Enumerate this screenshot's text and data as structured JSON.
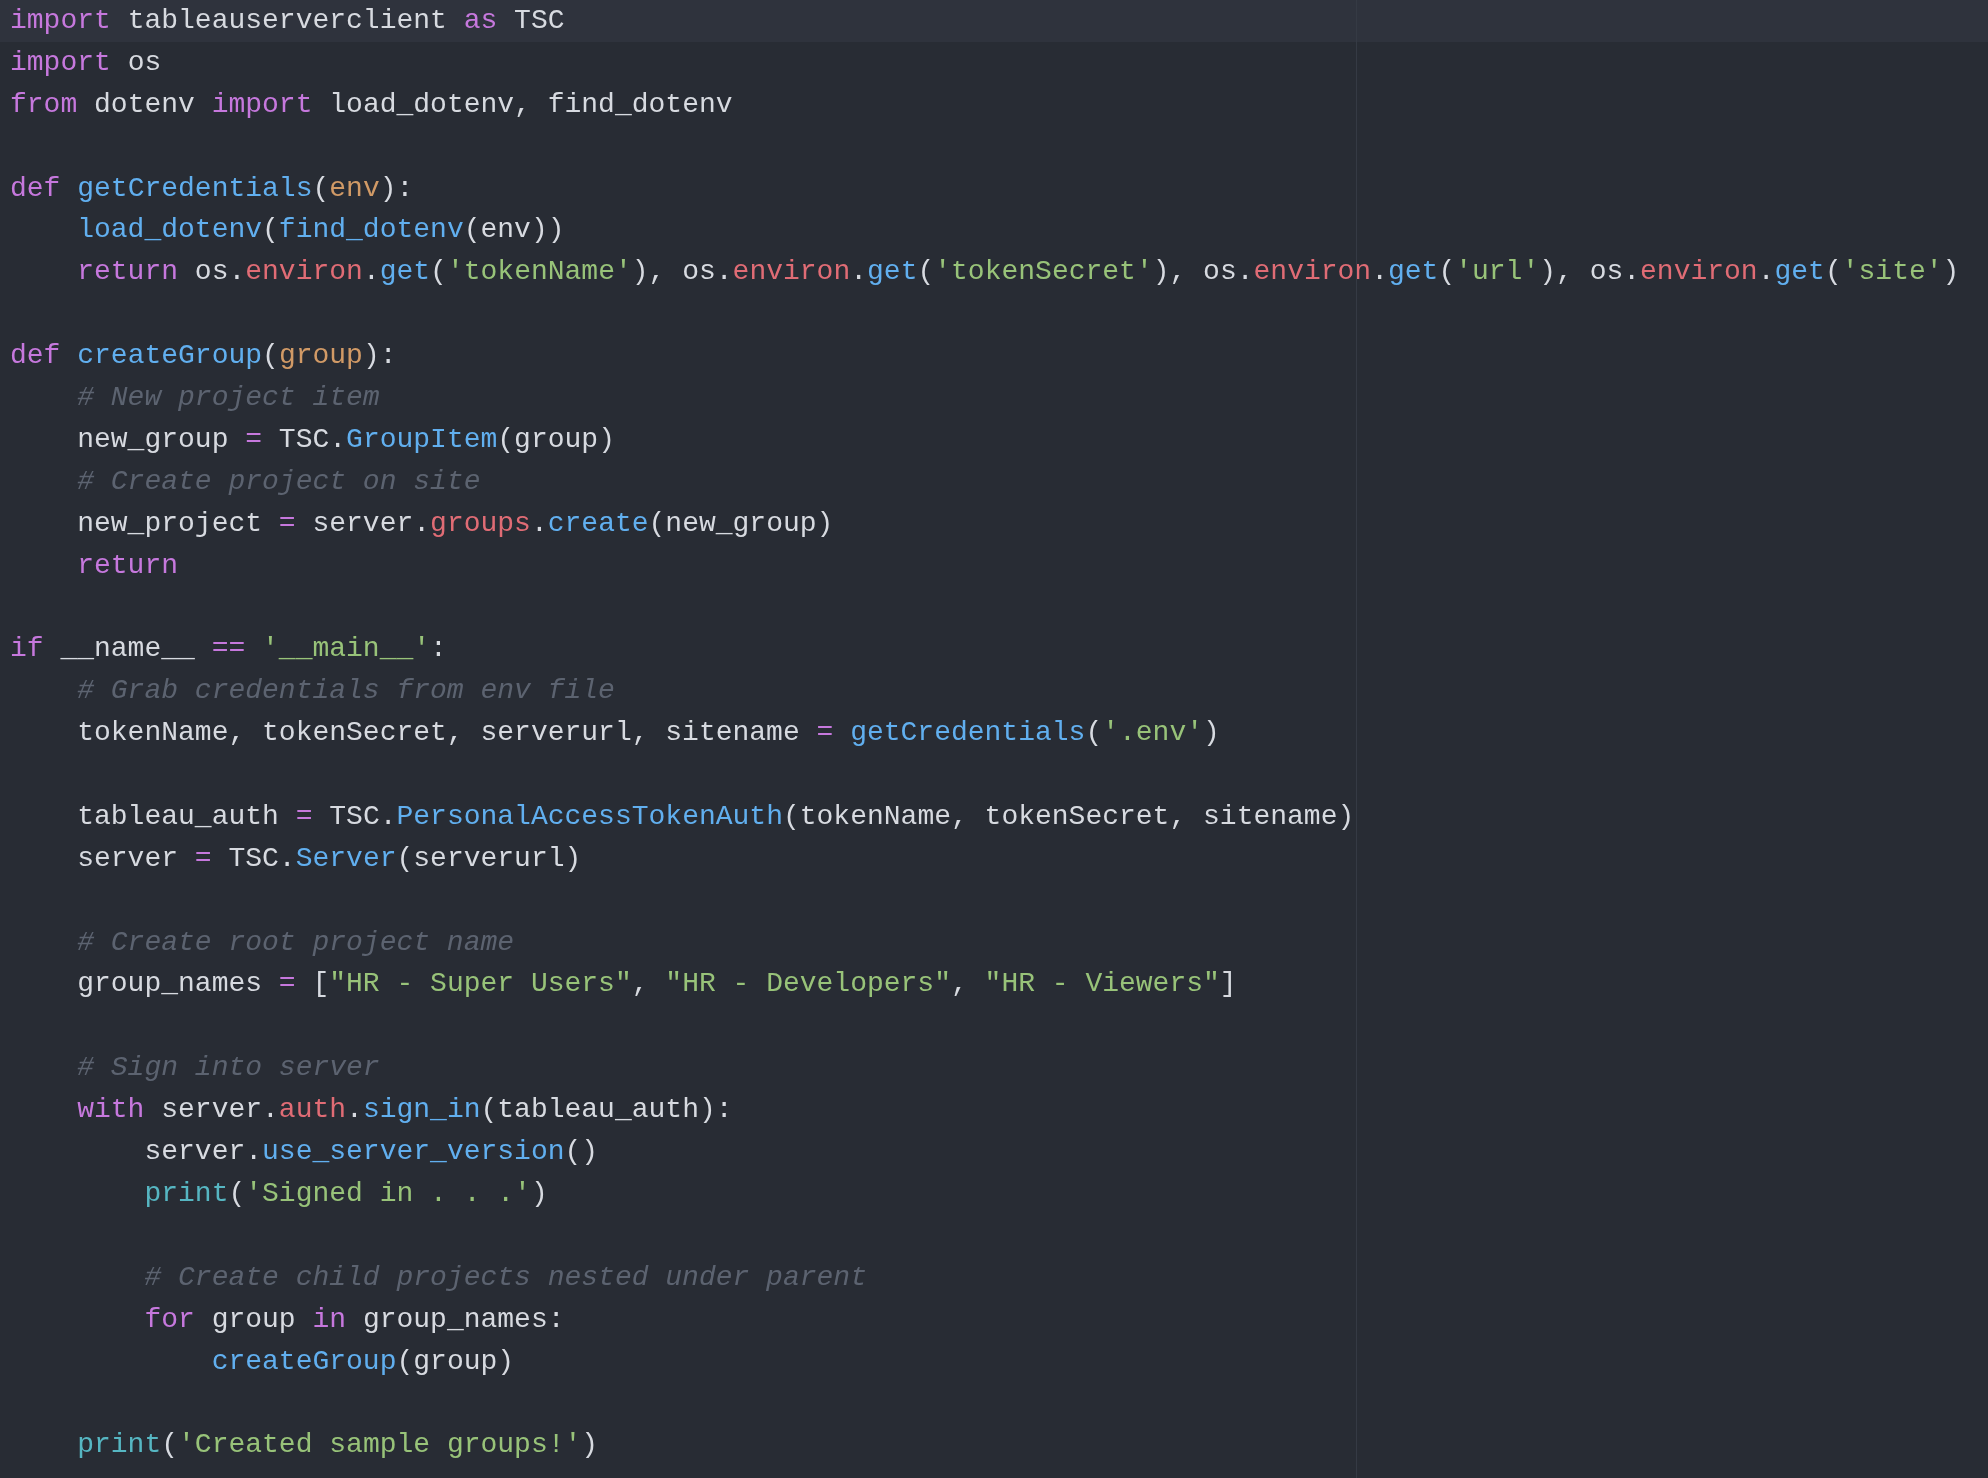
{
  "editor": {
    "blocks": [
      {
        "lines": [
          {
            "current": true,
            "tokens": [
              {
                "kind": "keyword",
                "text": "import"
              },
              {
                "kind": "plain",
                "text": " tableauserverclient "
              },
              {
                "kind": "keyword",
                "text": "as"
              },
              {
                "kind": "plain",
                "text": " TSC"
              }
            ]
          },
          {
            "current": false,
            "tokens": [
              {
                "kind": "keyword",
                "text": "import"
              },
              {
                "kind": "plain",
                "text": " os"
              }
            ]
          },
          {
            "current": false,
            "tokens": [
              {
                "kind": "keyword",
                "text": "from"
              },
              {
                "kind": "plain",
                "text": " dotenv "
              },
              {
                "kind": "keyword",
                "text": "import"
              },
              {
                "kind": "plain",
                "text": " load_dotenv, find_dotenv"
              }
            ]
          }
        ]
      },
      {
        "lines": [
          {
            "current": false,
            "tokens": [
              {
                "kind": "keyword",
                "text": "def "
              },
              {
                "kind": "function",
                "text": "getCredentials"
              },
              {
                "kind": "plain",
                "text": "("
              },
              {
                "kind": "parameter",
                "text": "env"
              },
              {
                "kind": "plain",
                "text": "):"
              }
            ]
          },
          {
            "current": false,
            "tokens": [
              {
                "kind": "function",
                "text": "    load_dotenv"
              },
              {
                "kind": "plain",
                "text": "("
              },
              {
                "kind": "function",
                "text": "find_dotenv"
              },
              {
                "kind": "plain",
                "text": "(env))"
              }
            ]
          },
          {
            "current": false,
            "tokens": [
              {
                "kind": "keyword",
                "text": "    return"
              },
              {
                "kind": "plain",
                "text": " os."
              },
              {
                "kind": "property",
                "text": "environ"
              },
              {
                "kind": "plain",
                "text": "."
              },
              {
                "kind": "function",
                "text": "get"
              },
              {
                "kind": "plain",
                "text": "("
              },
              {
                "kind": "string",
                "text": "'tokenName'"
              },
              {
                "kind": "plain",
                "text": "), os."
              },
              {
                "kind": "property",
                "text": "environ"
              },
              {
                "kind": "plain",
                "text": "."
              },
              {
                "kind": "function",
                "text": "get"
              },
              {
                "kind": "plain",
                "text": "("
              },
              {
                "kind": "string",
                "text": "'tokenSecret'"
              },
              {
                "kind": "plain",
                "text": "), os."
              },
              {
                "kind": "property",
                "text": "environ"
              },
              {
                "kind": "plain",
                "text": "."
              },
              {
                "kind": "function",
                "text": "get"
              },
              {
                "kind": "plain",
                "text": "("
              },
              {
                "kind": "string",
                "text": "'url'"
              },
              {
                "kind": "plain",
                "text": "), os."
              },
              {
                "kind": "property",
                "text": "environ"
              },
              {
                "kind": "plain",
                "text": "."
              },
              {
                "kind": "function",
                "text": "get"
              },
              {
                "kind": "plain",
                "text": "("
              },
              {
                "kind": "string",
                "text": "'site'"
              },
              {
                "kind": "plain",
                "text": ")"
              }
            ]
          }
        ]
      },
      {
        "lines": [
          {
            "current": false,
            "tokens": [
              {
                "kind": "keyword",
                "text": "def "
              },
              {
                "kind": "function",
                "text": "createGroup"
              },
              {
                "kind": "plain",
                "text": "("
              },
              {
                "kind": "parameter",
                "text": "group"
              },
              {
                "kind": "plain",
                "text": "):"
              }
            ]
          },
          {
            "current": false,
            "tokens": [
              {
                "kind": "comment",
                "text": "    # New project item"
              }
            ]
          },
          {
            "current": false,
            "tokens": [
              {
                "kind": "plain",
                "text": "    new_group "
              },
              {
                "kind": "operator",
                "text": "="
              },
              {
                "kind": "plain",
                "text": " TSC."
              },
              {
                "kind": "function",
                "text": "GroupItem"
              },
              {
                "kind": "plain",
                "text": "(group)"
              }
            ]
          },
          {
            "current": false,
            "tokens": [
              {
                "kind": "comment",
                "text": "    # Create project on site"
              }
            ]
          },
          {
            "current": false,
            "tokens": [
              {
                "kind": "plain",
                "text": "    new_project "
              },
              {
                "kind": "operator",
                "text": "="
              },
              {
                "kind": "plain",
                "text": " server."
              },
              {
                "kind": "property",
                "text": "groups"
              },
              {
                "kind": "plain",
                "text": "."
              },
              {
                "kind": "function",
                "text": "create"
              },
              {
                "kind": "plain",
                "text": "(new_group)"
              }
            ]
          },
          {
            "current": false,
            "tokens": [
              {
                "kind": "keyword",
                "text": "    return"
              }
            ]
          }
        ]
      },
      {
        "lines": [
          {
            "current": false,
            "tokens": [
              {
                "kind": "keyword",
                "text": "if"
              },
              {
                "kind": "plain",
                "text": " __name__ "
              },
              {
                "kind": "operator",
                "text": "=="
              },
              {
                "kind": "string",
                "text": " '__main__'"
              },
              {
                "kind": "plain",
                "text": ":"
              }
            ]
          },
          {
            "current": false,
            "tokens": [
              {
                "kind": "comment",
                "text": "    # Grab credentials from env file"
              }
            ]
          },
          {
            "current": false,
            "tokens": [
              {
                "kind": "plain",
                "text": "    tokenName, tokenSecret, serverurl, sitename "
              },
              {
                "kind": "operator",
                "text": "="
              },
              {
                "kind": "function",
                "text": " getCredentials"
              },
              {
                "kind": "plain",
                "text": "("
              },
              {
                "kind": "string",
                "text": "'.env'"
              },
              {
                "kind": "plain",
                "text": ")"
              }
            ]
          }
        ]
      },
      {
        "lines": [
          {
            "current": false,
            "tokens": [
              {
                "kind": "plain",
                "text": "    tableau_auth "
              },
              {
                "kind": "operator",
                "text": "="
              },
              {
                "kind": "plain",
                "text": " TSC."
              },
              {
                "kind": "function",
                "text": "PersonalAccessTokenAuth"
              },
              {
                "kind": "plain",
                "text": "(tokenName, tokenSecret, sitename)"
              }
            ]
          },
          {
            "current": false,
            "tokens": [
              {
                "kind": "plain",
                "text": "    server "
              },
              {
                "kind": "operator",
                "text": "="
              },
              {
                "kind": "plain",
                "text": " TSC."
              },
              {
                "kind": "function",
                "text": "Server"
              },
              {
                "kind": "plain",
                "text": "(serverurl)"
              }
            ]
          }
        ]
      },
      {
        "lines": [
          {
            "current": false,
            "tokens": [
              {
                "kind": "comment",
                "text": "    # Create root project name"
              }
            ]
          },
          {
            "current": false,
            "tokens": [
              {
                "kind": "plain",
                "text": "    group_names "
              },
              {
                "kind": "operator",
                "text": "="
              },
              {
                "kind": "plain",
                "text": " ["
              },
              {
                "kind": "string",
                "text": "\"HR - Super Users\""
              },
              {
                "kind": "plain",
                "text": ", "
              },
              {
                "kind": "string",
                "text": "\"HR - Developers\""
              },
              {
                "kind": "plain",
                "text": ", "
              },
              {
                "kind": "string",
                "text": "\"HR - Viewers\""
              },
              {
                "kind": "plain",
                "text": "]"
              }
            ]
          }
        ]
      },
      {
        "lines": [
          {
            "current": false,
            "tokens": [
              {
                "kind": "comment",
                "text": "    # Sign into server"
              }
            ]
          },
          {
            "current": false,
            "tokens": [
              {
                "kind": "keyword",
                "text": "    with"
              },
              {
                "kind": "plain",
                "text": " server."
              },
              {
                "kind": "property",
                "text": "auth"
              },
              {
                "kind": "plain",
                "text": "."
              },
              {
                "kind": "function",
                "text": "sign_in"
              },
              {
                "kind": "plain",
                "text": "(tableau_auth):"
              }
            ]
          },
          {
            "current": false,
            "tokens": [
              {
                "kind": "plain",
                "text": "        server."
              },
              {
                "kind": "function",
                "text": "use_server_version"
              },
              {
                "kind": "plain",
                "text": "()"
              }
            ]
          },
          {
            "current": false,
            "tokens": [
              {
                "kind": "builtin",
                "text": "        print"
              },
              {
                "kind": "plain",
                "text": "("
              },
              {
                "kind": "string",
                "text": "'Signed in . . .'"
              },
              {
                "kind": "plain",
                "text": ")"
              }
            ]
          }
        ]
      },
      {
        "lines": [
          {
            "current": false,
            "tokens": [
              {
                "kind": "comment",
                "text": "        # Create child projects nested under parent"
              }
            ]
          },
          {
            "current": false,
            "tokens": [
              {
                "kind": "keyword",
                "text": "        for"
              },
              {
                "kind": "plain",
                "text": " group "
              },
              {
                "kind": "keyword",
                "text": "in"
              },
              {
                "kind": "plain",
                "text": " group_names:"
              }
            ]
          },
          {
            "current": false,
            "tokens": [
              {
                "kind": "function",
                "text": "            createGroup"
              },
              {
                "kind": "plain",
                "text": "(group)"
              }
            ]
          }
        ]
      },
      {
        "lines": [
          {
            "current": false,
            "tokens": [
              {
                "kind": "builtin",
                "text": "    print"
              },
              {
                "kind": "plain",
                "text": "("
              },
              {
                "kind": "string",
                "text": "'Created sample groups!'"
              },
              {
                "kind": "plain",
                "text": ")"
              }
            ]
          }
        ]
      }
    ]
  }
}
